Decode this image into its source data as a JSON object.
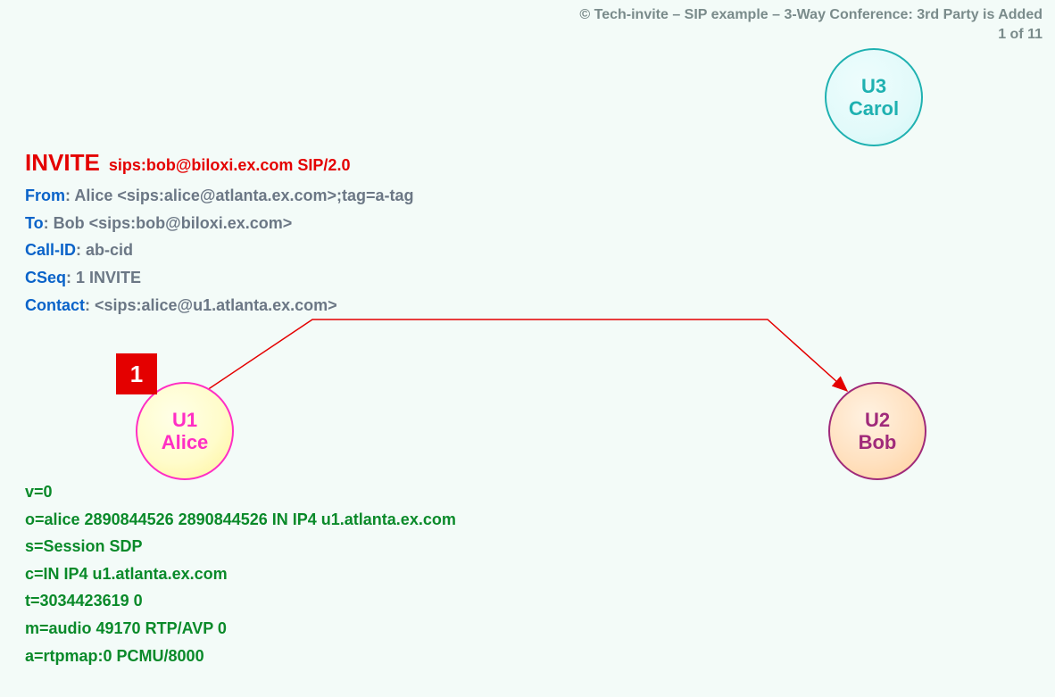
{
  "header": {
    "title": "© Tech-invite – SIP example – 3-Way Conference: 3rd Party is Added",
    "page": "1 of 11"
  },
  "nodes": {
    "u1": {
      "id": "U1",
      "name": "Alice"
    },
    "u2": {
      "id": "U2",
      "name": "Bob"
    },
    "u3": {
      "id": "U3",
      "name": "Carol"
    }
  },
  "step": {
    "number": "1"
  },
  "sip": {
    "method": "INVITE",
    "request_uri": "sips:bob@biloxi.ex.com SIP/2.0",
    "headers": {
      "from_label": "From",
      "from_value": ": Alice <sips:alice@atlanta.ex.com>;tag=a-tag",
      "to_label": "To",
      "to_value": ": Bob <sips:bob@biloxi.ex.com>",
      "callid_label": "Call-ID",
      "callid_value": ": ab-cid",
      "cseq_label": "CSeq",
      "cseq_value": ": 1 INVITE",
      "contact_label": "Contact",
      "contact_value": ": <sips:alice@u1.atlanta.ex.com>"
    }
  },
  "sdp": {
    "l0": "v=0",
    "l1": "o=alice  2890844526  2890844526  IN  IP4  u1.atlanta.ex.com",
    "l2": "s=Session SDP",
    "l3": "c=IN  IP4  u1.atlanta.ex.com",
    "l4": "t=3034423619  0",
    "l5": "m=audio  49170  RTP/AVP  0",
    "l6": "a=rtpmap:0  PCMU/8000"
  },
  "arrow": {
    "from": "U1",
    "to": "U2",
    "color": "#e40000"
  }
}
